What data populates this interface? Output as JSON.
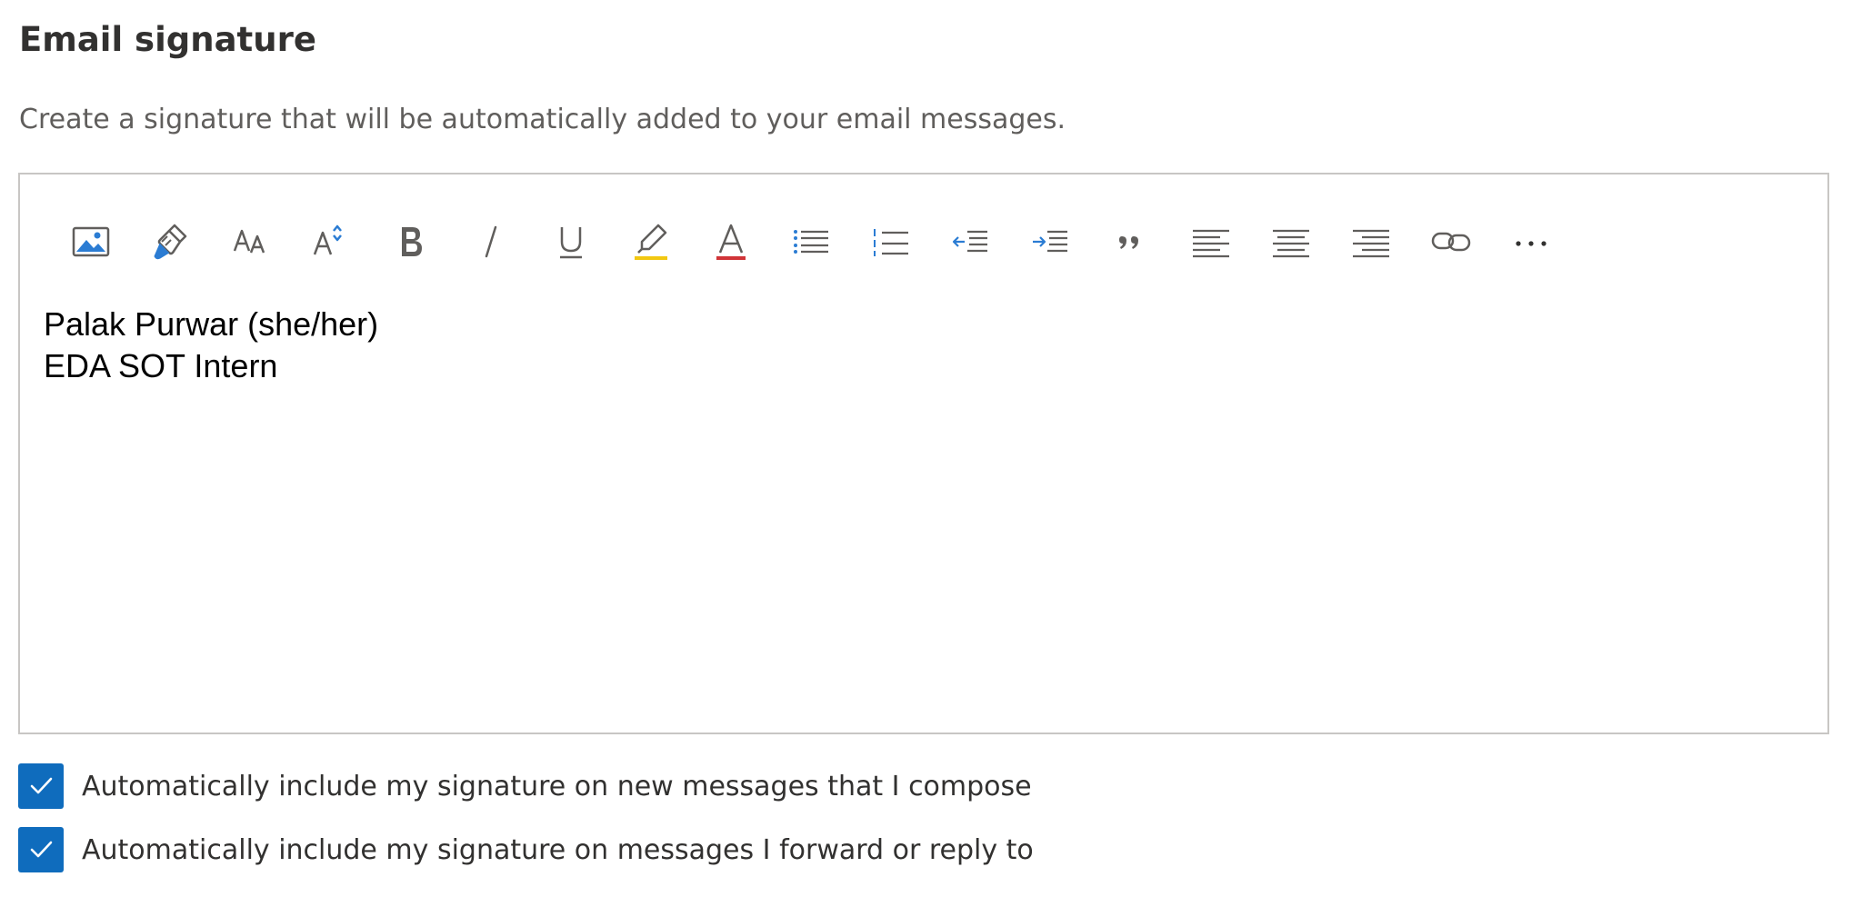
{
  "section": {
    "title": "Email signature",
    "description": "Create a signature that will be automatically added to your email messages."
  },
  "toolbar": [
    {
      "name": "insert-picture-icon"
    },
    {
      "name": "format-painter-icon"
    },
    {
      "name": "font-size-icon"
    },
    {
      "name": "change-case-icon"
    },
    {
      "name": "bold-icon"
    },
    {
      "name": "italic-icon"
    },
    {
      "name": "underline-icon"
    },
    {
      "name": "highlight-icon"
    },
    {
      "name": "font-color-icon"
    },
    {
      "name": "bullets-icon"
    },
    {
      "name": "numbering-icon"
    },
    {
      "name": "decrease-indent-icon"
    },
    {
      "name": "increase-indent-icon"
    },
    {
      "name": "quote-icon"
    },
    {
      "name": "align-left-icon"
    },
    {
      "name": "align-center-icon"
    },
    {
      "name": "align-right-icon"
    },
    {
      "name": "link-icon"
    },
    {
      "name": "more-options-icon"
    }
  ],
  "editor": {
    "lines": [
      "Palak Purwar (she/her)",
      "EDA SOT Intern"
    ]
  },
  "options": [
    {
      "label": "Automatically include my signature on new messages that I compose",
      "checked": true
    },
    {
      "label": "Automatically include my signature on messages I forward or reply to",
      "checked": true
    }
  ],
  "colors": {
    "accent": "#0f6cbd",
    "icon_gray": "#605e5c",
    "icon_blue": "#2b7cd3",
    "highlight_yellow": "#f2c811",
    "font_color_red": "#d13438"
  }
}
